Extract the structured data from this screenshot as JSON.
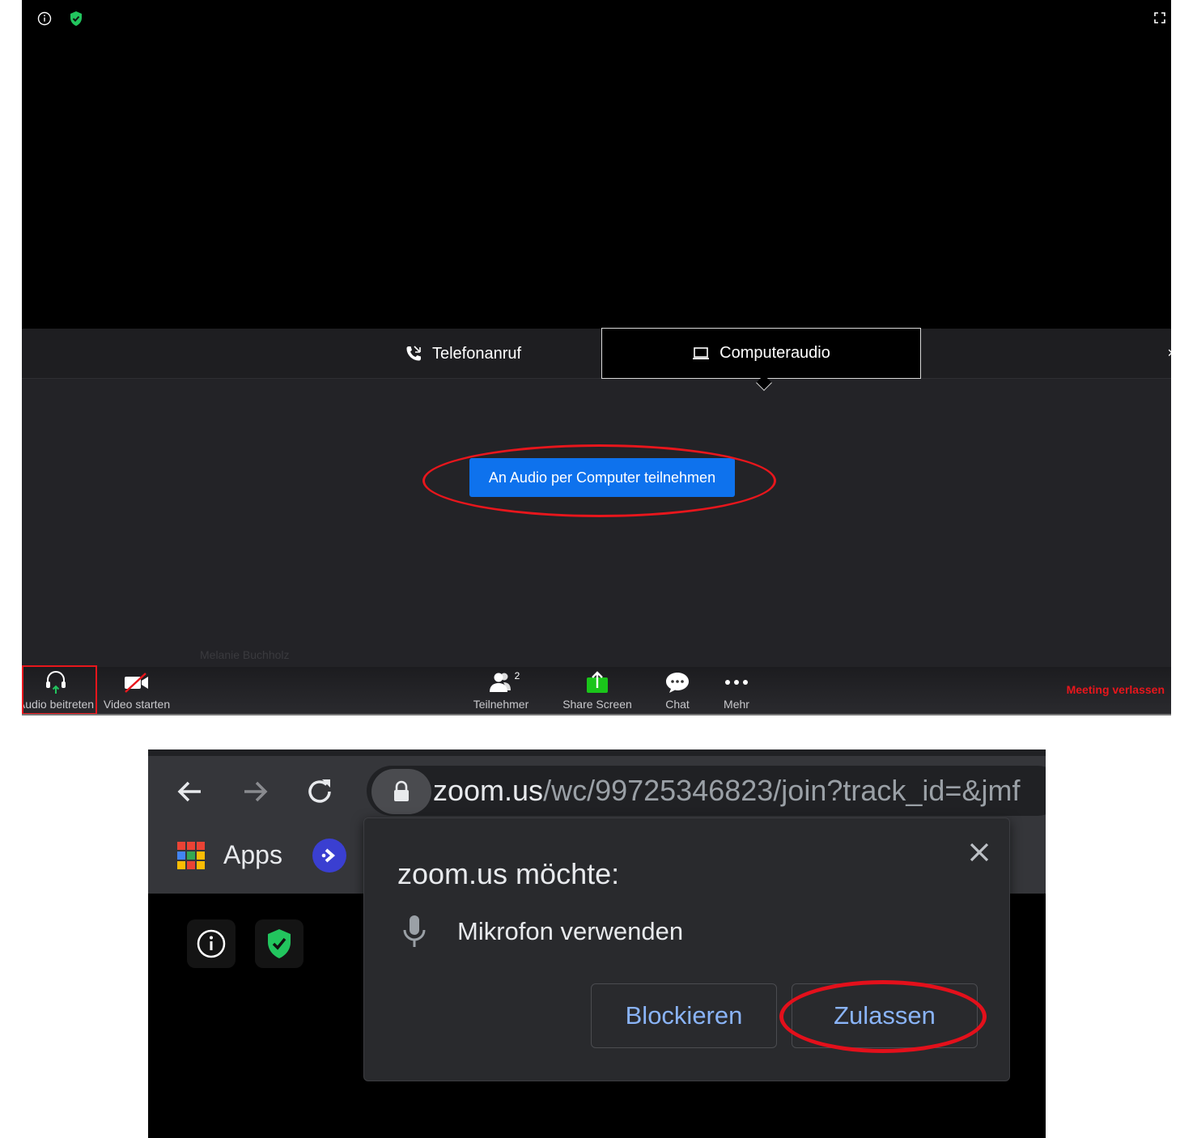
{
  "zoom": {
    "audio_tabs": {
      "phone_label": "Telefonanruf",
      "computer_label": "Computeraudio",
      "close_glyph": "×"
    },
    "join_audio_button": "An Audio per Computer teilnehmen",
    "participant_name": "Melanie Buchholz",
    "toolbar": {
      "audio_label": "Audio beitreten",
      "video_label": "Video starten",
      "participants_label": "Teilnehmer",
      "participants_count": "2",
      "share_label": "Share Screen",
      "chat_label": "Chat",
      "more_label": "Mehr",
      "leave_label": "Meeting verlassen"
    },
    "colors": {
      "accent_blue": "#0e72ed",
      "leave_red": "#e8161c",
      "share_green": "#1ac51a",
      "annotation_red": "#e8161c"
    },
    "icons": [
      "info-icon",
      "shield-check-icon",
      "fullscreen-icon",
      "phone-icon",
      "laptop-icon",
      "headphones-icon",
      "video-off-icon",
      "participants-icon",
      "share-screen-icon",
      "chat-icon",
      "more-icon"
    ]
  },
  "chrome": {
    "url_host": "zoom.us",
    "url_path": "/wc/99725346823/join?track_id=&jmf",
    "bookmarks": {
      "apps_label": "Apps"
    },
    "permission": {
      "title": "zoom.us möchte:",
      "request": "Mikrofon verwenden",
      "block_label": "Blockieren",
      "allow_label": "Zulassen",
      "close_glyph": "✕"
    },
    "colors": {
      "button_text": "#8ab4f8",
      "annotation_red": "#e3101b"
    },
    "icons": [
      "back-arrow-icon",
      "forward-arrow-icon",
      "reload-icon",
      "lock-icon",
      "apps-grid-icon",
      "extension-icon",
      "info-icon",
      "shield-check-icon",
      "microphone-icon",
      "close-icon"
    ]
  }
}
